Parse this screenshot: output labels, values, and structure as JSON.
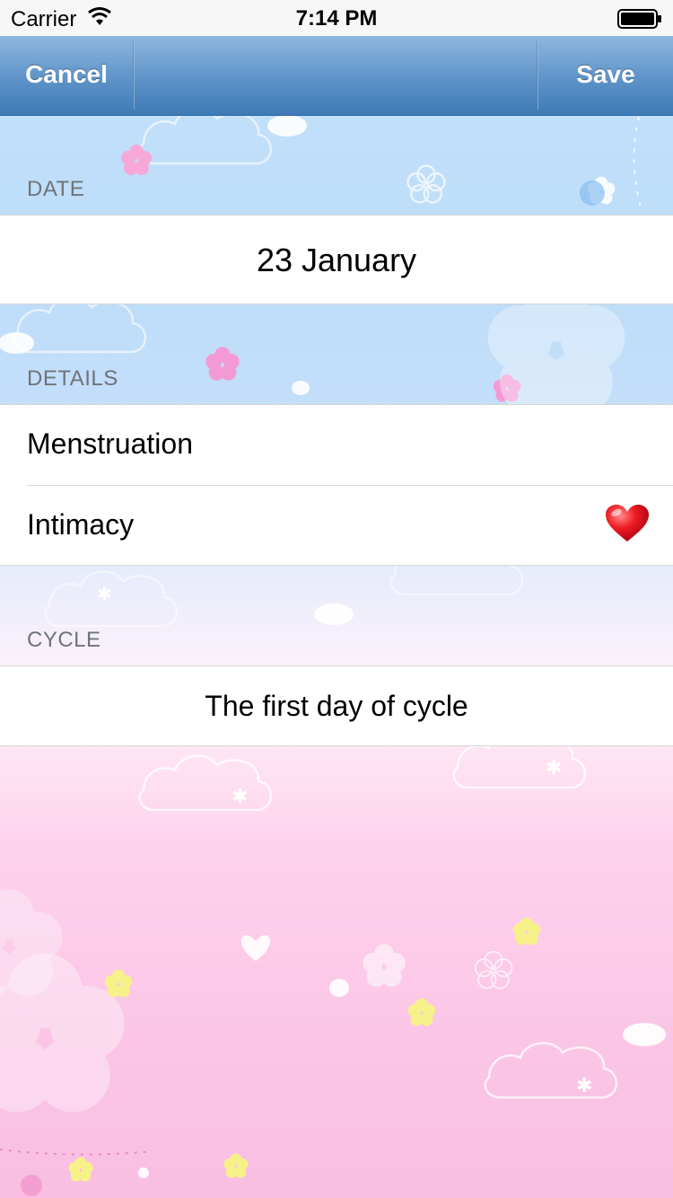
{
  "status_bar": {
    "carrier": "Carrier",
    "time": "7:14 PM"
  },
  "nav": {
    "cancel_label": "Cancel",
    "save_label": "Save"
  },
  "sections": {
    "date": {
      "header": "DATE",
      "value": "23 January"
    },
    "details": {
      "header": "DETAILS",
      "items": [
        {
          "label": "Menstruation",
          "icon": ""
        },
        {
          "label": "Intimacy",
          "icon": "heart-icon"
        }
      ]
    },
    "cycle": {
      "header": "CYCLE",
      "value": "The first day of cycle"
    }
  },
  "colors": {
    "nav_top": "#8fb7df",
    "nav_bottom": "#3f7ab6",
    "heart": "#e3131c",
    "header_text": "#6f7479"
  }
}
